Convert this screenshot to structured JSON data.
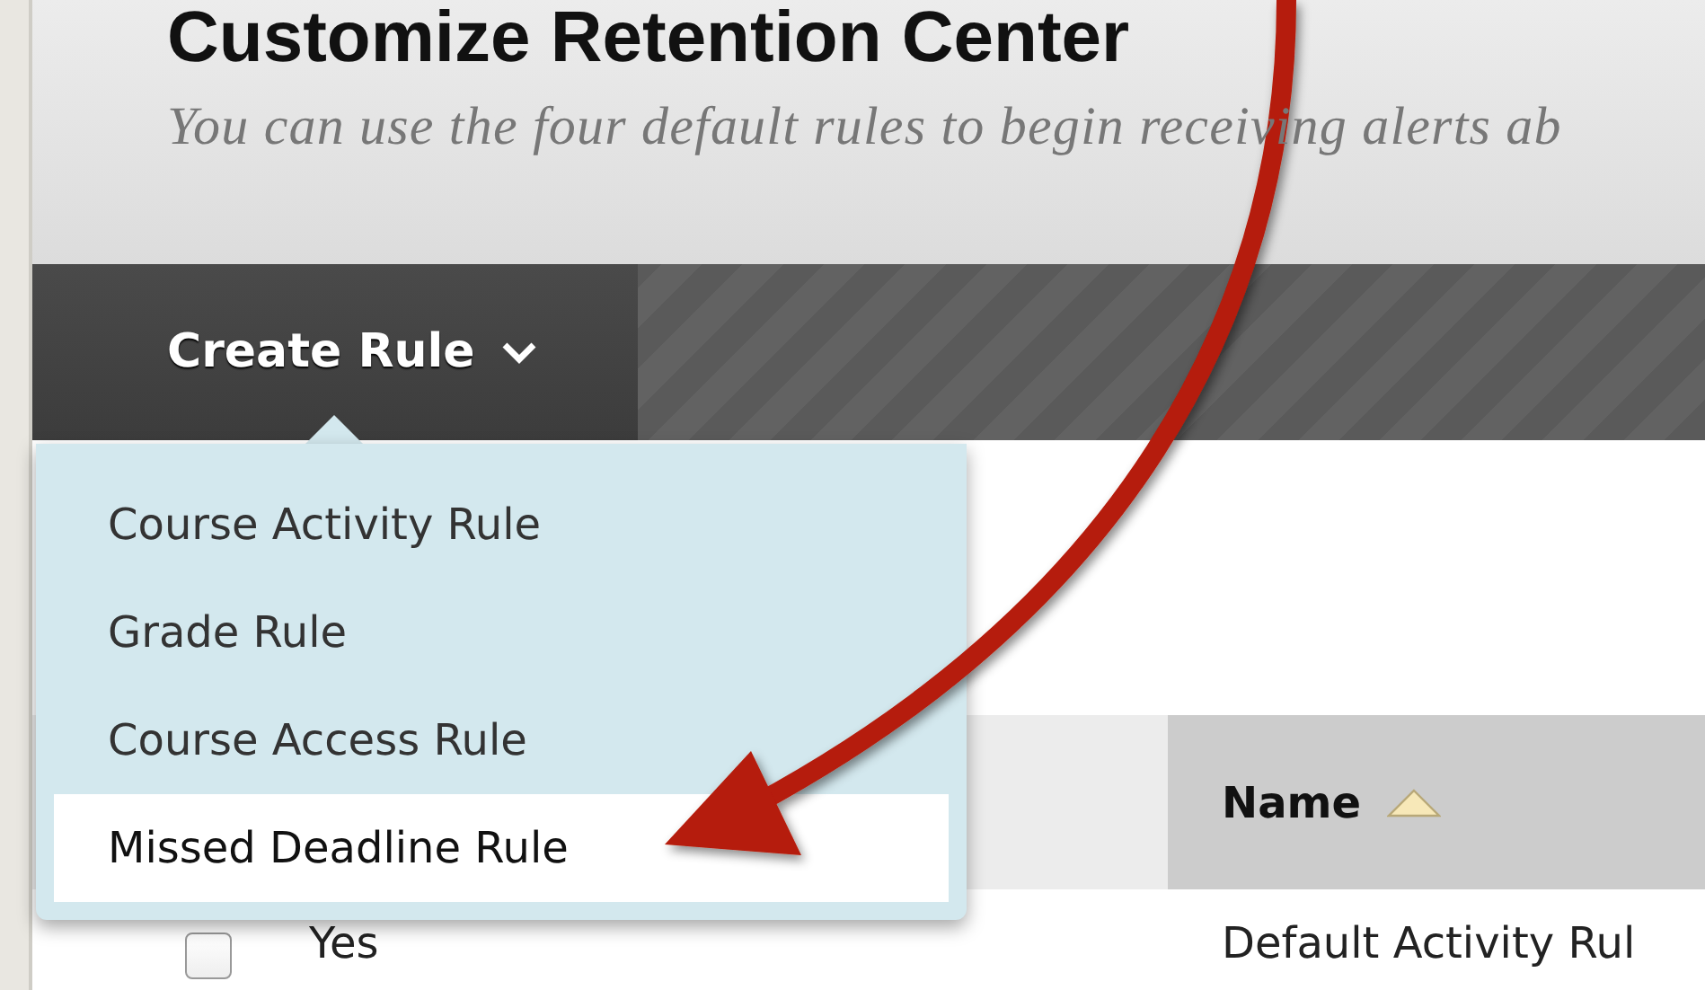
{
  "header": {
    "title": "Customize Retention Center",
    "subtitle": "You can use the four default rules to begin receiving alerts ab"
  },
  "toolbar": {
    "button": {
      "label": "Create Rule",
      "expanded": true
    }
  },
  "menu": {
    "items": [
      {
        "label": "Course Activity Rule",
        "highlighted": false
      },
      {
        "label": "Grade Rule",
        "highlighted": false
      },
      {
        "label": "Course Access Rule",
        "highlighted": false
      },
      {
        "label": "Missed Deadline Rule",
        "highlighted": true
      }
    ]
  },
  "table": {
    "columns": [
      {
        "kind": "blank"
      },
      {
        "kind": "text",
        "label": "Name",
        "sorted": true
      }
    ],
    "rows": [
      {
        "checked": false,
        "column_1": "Yes",
        "name": "Default Activity Rul"
      }
    ]
  }
}
